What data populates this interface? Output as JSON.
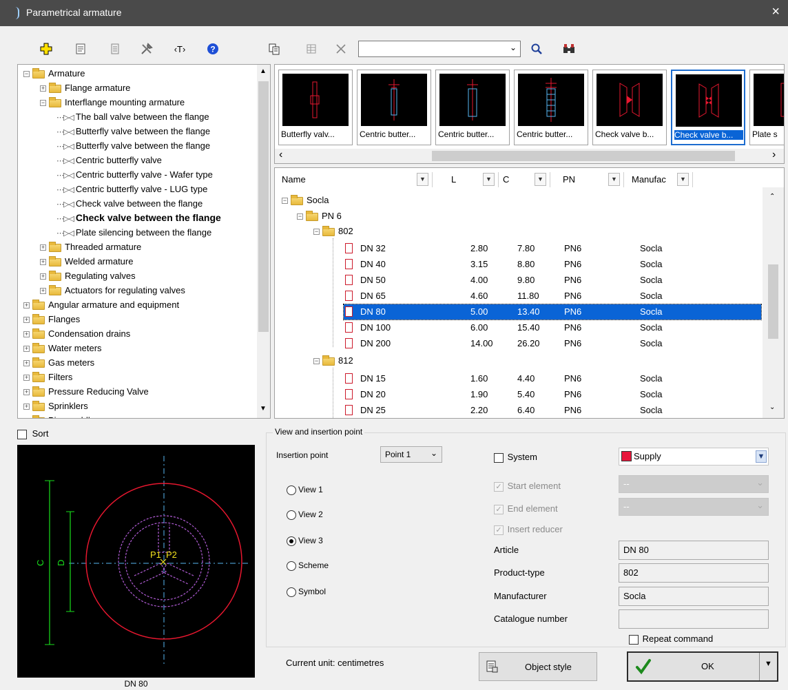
{
  "window": {
    "title": "Parametrical armature",
    "close_glyph": "×"
  },
  "toolbar": {
    "left_icons": [
      "add-icon",
      "properties-icon",
      "document-icon",
      "tools-icon",
      "text-tag-icon",
      "help-icon"
    ],
    "right_icons": [
      "copy-icon",
      "table-icon",
      "delete-icon"
    ],
    "text_tag": "‹T›",
    "search_value": "",
    "search_icon": "search-icon",
    "binoculars_icon": "binoculars-icon"
  },
  "tree": {
    "items": [
      {
        "label": "Armature",
        "indent": 0,
        "exp": "−",
        "kind": "folder"
      },
      {
        "label": "Flange armature",
        "indent": 1,
        "exp": "+",
        "kind": "folder"
      },
      {
        "label": "Interflange mounting armature",
        "indent": 1,
        "exp": "−",
        "kind": "folder"
      },
      {
        "label": "The ball valve between the flange",
        "indent": 2,
        "exp": "",
        "kind": "item"
      },
      {
        "label": "Butterfly valve between the flange",
        "indent": 2,
        "exp": "",
        "kind": "item"
      },
      {
        "label": "Butterfly valve between the flange",
        "indent": 2,
        "exp": "",
        "kind": "item"
      },
      {
        "label": "Centric butterfly valve",
        "indent": 2,
        "exp": "",
        "kind": "item"
      },
      {
        "label": "Centric butterfly valve - Wafer type",
        "indent": 2,
        "exp": "",
        "kind": "item"
      },
      {
        "label": "Centric butterfly valve - LUG type",
        "indent": 2,
        "exp": "",
        "kind": "item"
      },
      {
        "label": "Check valve between the flange",
        "indent": 2,
        "exp": "",
        "kind": "item"
      },
      {
        "label": "Check valve between the flange",
        "indent": 2,
        "exp": "",
        "kind": "item",
        "selected": true
      },
      {
        "label": "Plate silencing between the flange",
        "indent": 2,
        "exp": "",
        "kind": "item"
      },
      {
        "label": "Threaded armature",
        "indent": 1,
        "exp": "+",
        "kind": "folder"
      },
      {
        "label": "Welded armature",
        "indent": 1,
        "exp": "+",
        "kind": "folder"
      },
      {
        "label": "Regulating valves",
        "indent": 1,
        "exp": "+",
        "kind": "folder"
      },
      {
        "label": "Actuators for regulating valves",
        "indent": 1,
        "exp": "+",
        "kind": "folder"
      },
      {
        "label": "Angular armature and equipment",
        "indent": 0,
        "exp": "+",
        "kind": "folder"
      },
      {
        "label": "Flanges",
        "indent": 0,
        "exp": "+",
        "kind": "folder"
      },
      {
        "label": "Condensation drains",
        "indent": 0,
        "exp": "+",
        "kind": "folder"
      },
      {
        "label": "Water meters",
        "indent": 0,
        "exp": "+",
        "kind": "folder"
      },
      {
        "label": "Gas meters",
        "indent": 0,
        "exp": "+",
        "kind": "folder"
      },
      {
        "label": "Filters",
        "indent": 0,
        "exp": "+",
        "kind": "folder"
      },
      {
        "label": "Pressure Reducing Valve",
        "indent": 0,
        "exp": "+",
        "kind": "folder"
      },
      {
        "label": "Sprinklers",
        "indent": 0,
        "exp": "+",
        "kind": "folder"
      },
      {
        "label": "Pipe saddles",
        "indent": 0,
        "exp": "+",
        "kind": "folder"
      }
    ]
  },
  "gallery": {
    "cards": [
      {
        "label": "Butterfly valv...",
        "selected": false
      },
      {
        "label": "Centric butter...",
        "selected": false
      },
      {
        "label": "Centric butter...",
        "selected": false
      },
      {
        "label": "Centric butter...",
        "selected": false
      },
      {
        "label": "Check valve b...",
        "selected": false
      },
      {
        "label": "Check valve b...",
        "selected": true
      },
      {
        "label": "Plate s",
        "selected": false
      }
    ],
    "scroll_left": "‹",
    "scroll_right": "›"
  },
  "table": {
    "columns": [
      "Name",
      "L",
      "C",
      "PN",
      "Manufac"
    ],
    "groups": [
      {
        "label": "Socla",
        "level": 0
      },
      {
        "label": "PN 6",
        "level": 1
      },
      {
        "label": "802",
        "level": 2
      },
      {
        "label": "812",
        "level": 2
      }
    ],
    "rows_802": [
      {
        "name": "DN 32",
        "l": "2.80",
        "c": "7.80",
        "pn": "PN6",
        "man": "Socla"
      },
      {
        "name": "DN 40",
        "l": "3.15",
        "c": "8.80",
        "pn": "PN6",
        "man": "Socla"
      },
      {
        "name": "DN 50",
        "l": "4.00",
        "c": "9.80",
        "pn": "PN6",
        "man": "Socla"
      },
      {
        "name": "DN 65",
        "l": "4.60",
        "c": "11.80",
        "pn": "PN6",
        "man": "Socla"
      },
      {
        "name": "DN 80",
        "l": "5.00",
        "c": "13.40",
        "pn": "PN6",
        "man": "Socla",
        "selected": true
      },
      {
        "name": "DN 100",
        "l": "6.00",
        "c": "15.40",
        "pn": "PN6",
        "man": "Socla"
      },
      {
        "name": "DN 200",
        "l": "14.00",
        "c": "26.20",
        "pn": "PN6",
        "man": "Socla"
      }
    ],
    "rows_812": [
      {
        "name": "DN 15",
        "l": "1.60",
        "c": "4.40",
        "pn": "PN6",
        "man": "Socla"
      },
      {
        "name": "DN 20",
        "l": "1.90",
        "c": "5.40",
        "pn": "PN6",
        "man": "Socla"
      },
      {
        "name": "DN 25",
        "l": "2.20",
        "c": "6.40",
        "pn": "PN6",
        "man": "Socla"
      }
    ]
  },
  "sort": {
    "label": "Sort",
    "checked": false
  },
  "preview": {
    "caption": "DN 80",
    "dim_c": "C",
    "dim_d": "D",
    "p1": "P1",
    "p2": "P2",
    "colors": {
      "outer": "#e8172f",
      "inner": "#b15cd6",
      "dim": "#19e01c",
      "axis": "#58b7f5",
      "point": "#f2e11d"
    }
  },
  "view_group": {
    "title": "View and insertion point",
    "insertion_label": "Insertion point",
    "insertion_value": "Point 1",
    "views": [
      {
        "label": "View 1",
        "checked": false
      },
      {
        "label": "View 2",
        "checked": false
      },
      {
        "label": "View 3",
        "checked": true
      },
      {
        "label": "Scheme",
        "checked": false
      },
      {
        "label": "Symbol",
        "checked": false
      }
    ]
  },
  "system": {
    "label": "System",
    "checked": false,
    "value": "Supply",
    "color": "#e8173c",
    "start_label": "Start element",
    "end_label": "End element",
    "reducer_label": "Insert reducer",
    "start_value": "--",
    "end_value": "--"
  },
  "props": [
    {
      "label": "Article",
      "value": "DN 80"
    },
    {
      "label": "Product-type",
      "value": "802"
    },
    {
      "label": "Manufacturer",
      "value": "Socla"
    },
    {
      "label": "Catalogue number",
      "value": ""
    }
  ],
  "repeat": {
    "label": "Repeat command",
    "checked": false
  },
  "status": {
    "unit": "Current unit: centimetres"
  },
  "buttons": {
    "style": "Object style",
    "ok": "OK"
  }
}
